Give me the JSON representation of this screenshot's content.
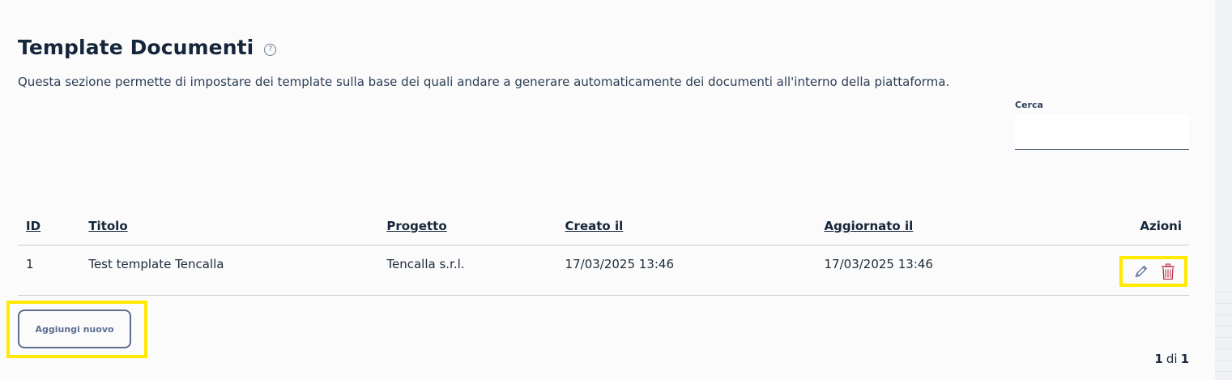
{
  "header": {
    "title": "Template Documenti",
    "help_icon": "help-circle-icon",
    "description": "Questa sezione permette di impostare dei template sulla base dei quali andare a generare automaticamente dei documenti all'interno della piattaforma."
  },
  "search": {
    "label": "Cerca",
    "value": "",
    "placeholder": ""
  },
  "table": {
    "columns": {
      "id": "ID",
      "title": "Titolo",
      "project": "Progetto",
      "created": "Creato il",
      "updated": "Aggiornato il",
      "actions": "Azioni"
    },
    "rows": [
      {
        "id": "1",
        "title": "Test template Tencalla",
        "project": "Tencalla s.r.l.",
        "created": "17/03/2025 13:46",
        "updated": "17/03/2025 13:46",
        "actions": [
          "pencil-icon",
          "trash-icon"
        ]
      }
    ]
  },
  "add_button": {
    "label": "Aggiungi nuovo"
  },
  "pagination": {
    "current": "1",
    "separator": "di",
    "total": "1"
  },
  "colors": {
    "highlight": "#ffea00",
    "delete": "#c0314a",
    "edit": "#5b6f91",
    "title": "#15263a"
  }
}
